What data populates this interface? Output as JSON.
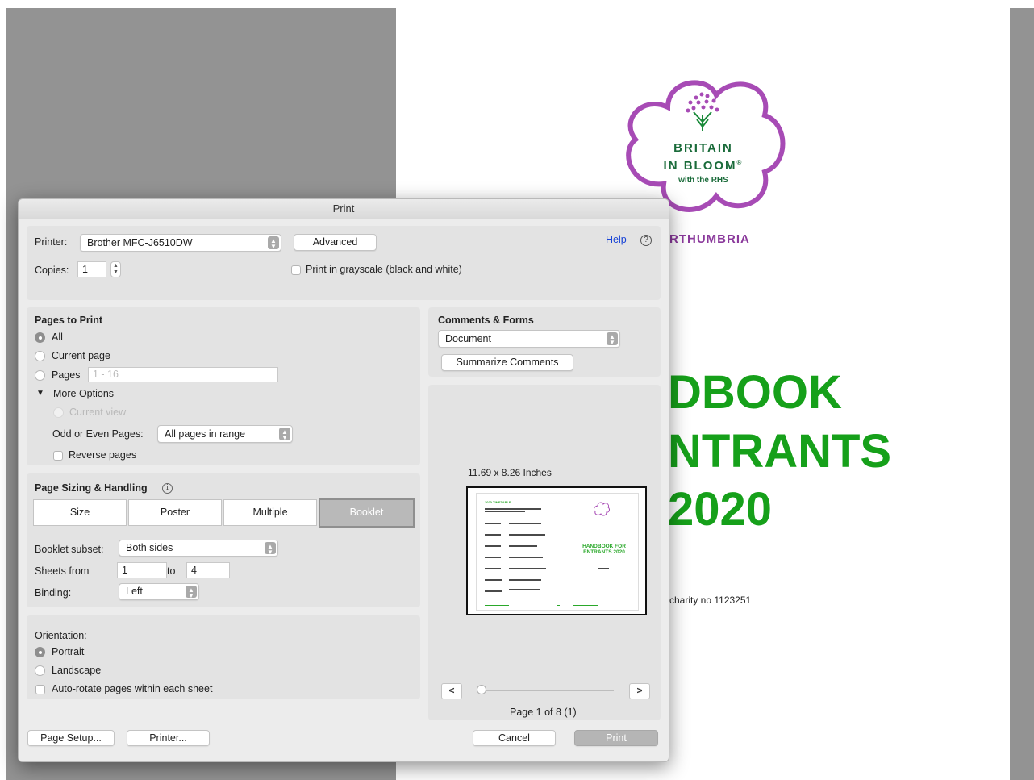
{
  "document": {
    "region": "RTHUMBRIA",
    "logo_line1": "BRITAIN",
    "logo_line2": "IN BLOOM",
    "logo_line3": "with the RHS",
    "title_line1": "DBOOK",
    "title_line2": "NTRANTS",
    "title_line3": "2020",
    "charity": "charity no 1123251"
  },
  "dialog": {
    "title": "Print",
    "printer_label": "Printer:",
    "printer_value": "Brother MFC-J6510DW",
    "advanced_label": "Advanced",
    "help_label": "Help",
    "copies_label": "Copies:",
    "copies_value": "1",
    "grayscale_label": "Print in grayscale (black and white)",
    "pages_to_print": {
      "header": "Pages to Print",
      "all": "All",
      "current_page": "Current page",
      "pages": "Pages",
      "pages_placeholder": "1 - 16",
      "more_options": "More Options",
      "current_view": "Current view",
      "odd_even_label": "Odd or Even Pages:",
      "odd_even_value": "All pages in range",
      "reverse_pages": "Reverse pages"
    },
    "page_sizing": {
      "header": "Page Sizing & Handling",
      "tabs": [
        "Size",
        "Poster",
        "Multiple",
        "Booklet"
      ],
      "active_tab": "Booklet",
      "booklet_subset_label": "Booklet subset:",
      "booklet_subset_value": "Both sides",
      "sheets_from_label": "Sheets from",
      "sheets_from_value": "1",
      "to_label": "to",
      "sheets_to_value": "4",
      "binding_label": "Binding:",
      "binding_value": "Left"
    },
    "orientation": {
      "header": "Orientation:",
      "portrait": "Portrait",
      "landscape": "Landscape",
      "auto_rotate": "Auto-rotate pages within each sheet"
    },
    "comments": {
      "header": "Comments & Forms",
      "value": "Document",
      "summarize_label": "Summarize Comments"
    },
    "preview": {
      "size_label": "11.69 x 8.26 Inches",
      "prev_label": "<",
      "next_label": ">",
      "page_info": "Page 1 of 8 (1)",
      "thumb_left_title": "2020 TIMETABLE",
      "thumb_right_title": "HANDBOOK FOR ENTRANTS 2020"
    },
    "buttons": {
      "page_setup": "Page Setup...",
      "printer": "Printer...",
      "cancel": "Cancel",
      "print": "Print"
    }
  },
  "colors": {
    "title_green": "#16a01a",
    "brand_purple": "#8b3a9c",
    "gray_backdrop": "#939393"
  }
}
